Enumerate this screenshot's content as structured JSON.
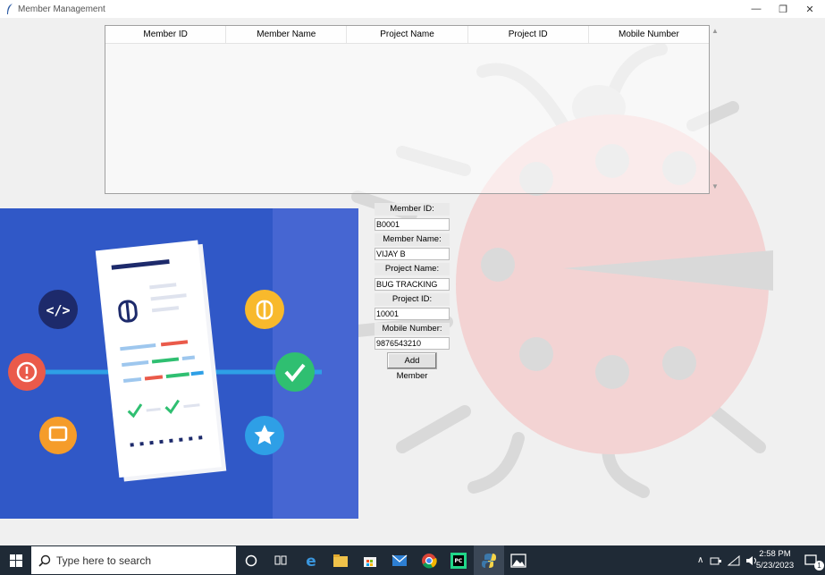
{
  "window": {
    "title": "Member Management",
    "controls": {
      "minimize": "—",
      "restore": "❐",
      "close": "✕"
    }
  },
  "table": {
    "columns": [
      "Member ID",
      "Member Name",
      "Project Name",
      "Project ID",
      "Mobile Number"
    ],
    "rows": []
  },
  "form": {
    "member_id_label": "Member ID:",
    "member_id_value": "B0001",
    "member_name_label": "Member Name:",
    "member_name_value": "VIJAY B",
    "project_name_label": "Project Name:",
    "project_name_value": "BUG TRACKING",
    "project_id_label": "Project ID:",
    "project_id_value": "10001",
    "mobile_label": "Mobile Number:",
    "mobile_value": "9876543210",
    "add_button": "Add Member"
  },
  "taskbar": {
    "search_placeholder": "Type here to search",
    "time": "2:58 PM",
    "date": "5/23/2023",
    "notification_count": "1",
    "icons": [
      "cortana-icon",
      "task-view-icon",
      "edge-icon",
      "file-explorer-icon",
      "store-icon",
      "mail-icon",
      "chrome-icon",
      "pycharm-icon",
      "python-icon",
      "photos-icon"
    ]
  },
  "colors": {
    "illustration_bg": "#3058c7",
    "watermark_red": "#f3d3d3",
    "watermark_grey": "#d9d9d9",
    "taskbar_bg": "#1f2a36"
  }
}
